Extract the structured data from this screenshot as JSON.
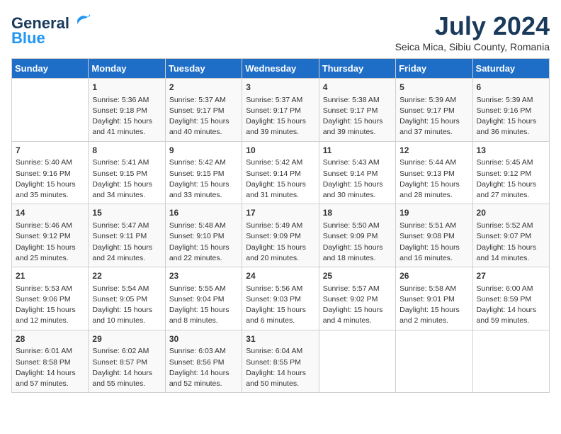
{
  "header": {
    "logo_line1": "General",
    "logo_line2": "Blue",
    "month_title": "July 2024",
    "subtitle": "Seica Mica, Sibiu County, Romania"
  },
  "days_of_week": [
    "Sunday",
    "Monday",
    "Tuesday",
    "Wednesday",
    "Thursday",
    "Friday",
    "Saturday"
  ],
  "weeks": [
    [
      {
        "day": "",
        "info": ""
      },
      {
        "day": "1",
        "info": "Sunrise: 5:36 AM\nSunset: 9:18 PM\nDaylight: 15 hours\nand 41 minutes."
      },
      {
        "day": "2",
        "info": "Sunrise: 5:37 AM\nSunset: 9:17 PM\nDaylight: 15 hours\nand 40 minutes."
      },
      {
        "day": "3",
        "info": "Sunrise: 5:37 AM\nSunset: 9:17 PM\nDaylight: 15 hours\nand 39 minutes."
      },
      {
        "day": "4",
        "info": "Sunrise: 5:38 AM\nSunset: 9:17 PM\nDaylight: 15 hours\nand 39 minutes."
      },
      {
        "day": "5",
        "info": "Sunrise: 5:39 AM\nSunset: 9:17 PM\nDaylight: 15 hours\nand 37 minutes."
      },
      {
        "day": "6",
        "info": "Sunrise: 5:39 AM\nSunset: 9:16 PM\nDaylight: 15 hours\nand 36 minutes."
      }
    ],
    [
      {
        "day": "7",
        "info": "Sunrise: 5:40 AM\nSunset: 9:16 PM\nDaylight: 15 hours\nand 35 minutes."
      },
      {
        "day": "8",
        "info": "Sunrise: 5:41 AM\nSunset: 9:15 PM\nDaylight: 15 hours\nand 34 minutes."
      },
      {
        "day": "9",
        "info": "Sunrise: 5:42 AM\nSunset: 9:15 PM\nDaylight: 15 hours\nand 33 minutes."
      },
      {
        "day": "10",
        "info": "Sunrise: 5:42 AM\nSunset: 9:14 PM\nDaylight: 15 hours\nand 31 minutes."
      },
      {
        "day": "11",
        "info": "Sunrise: 5:43 AM\nSunset: 9:14 PM\nDaylight: 15 hours\nand 30 minutes."
      },
      {
        "day": "12",
        "info": "Sunrise: 5:44 AM\nSunset: 9:13 PM\nDaylight: 15 hours\nand 28 minutes."
      },
      {
        "day": "13",
        "info": "Sunrise: 5:45 AM\nSunset: 9:12 PM\nDaylight: 15 hours\nand 27 minutes."
      }
    ],
    [
      {
        "day": "14",
        "info": "Sunrise: 5:46 AM\nSunset: 9:12 PM\nDaylight: 15 hours\nand 25 minutes."
      },
      {
        "day": "15",
        "info": "Sunrise: 5:47 AM\nSunset: 9:11 PM\nDaylight: 15 hours\nand 24 minutes."
      },
      {
        "day": "16",
        "info": "Sunrise: 5:48 AM\nSunset: 9:10 PM\nDaylight: 15 hours\nand 22 minutes."
      },
      {
        "day": "17",
        "info": "Sunrise: 5:49 AM\nSunset: 9:09 PM\nDaylight: 15 hours\nand 20 minutes."
      },
      {
        "day": "18",
        "info": "Sunrise: 5:50 AM\nSunset: 9:09 PM\nDaylight: 15 hours\nand 18 minutes."
      },
      {
        "day": "19",
        "info": "Sunrise: 5:51 AM\nSunset: 9:08 PM\nDaylight: 15 hours\nand 16 minutes."
      },
      {
        "day": "20",
        "info": "Sunrise: 5:52 AM\nSunset: 9:07 PM\nDaylight: 15 hours\nand 14 minutes."
      }
    ],
    [
      {
        "day": "21",
        "info": "Sunrise: 5:53 AM\nSunset: 9:06 PM\nDaylight: 15 hours\nand 12 minutes."
      },
      {
        "day": "22",
        "info": "Sunrise: 5:54 AM\nSunset: 9:05 PM\nDaylight: 15 hours\nand 10 minutes."
      },
      {
        "day": "23",
        "info": "Sunrise: 5:55 AM\nSunset: 9:04 PM\nDaylight: 15 hours\nand 8 minutes."
      },
      {
        "day": "24",
        "info": "Sunrise: 5:56 AM\nSunset: 9:03 PM\nDaylight: 15 hours\nand 6 minutes."
      },
      {
        "day": "25",
        "info": "Sunrise: 5:57 AM\nSunset: 9:02 PM\nDaylight: 15 hours\nand 4 minutes."
      },
      {
        "day": "26",
        "info": "Sunrise: 5:58 AM\nSunset: 9:01 PM\nDaylight: 15 hours\nand 2 minutes."
      },
      {
        "day": "27",
        "info": "Sunrise: 6:00 AM\nSunset: 8:59 PM\nDaylight: 14 hours\nand 59 minutes."
      }
    ],
    [
      {
        "day": "28",
        "info": "Sunrise: 6:01 AM\nSunset: 8:58 PM\nDaylight: 14 hours\nand 57 minutes."
      },
      {
        "day": "29",
        "info": "Sunrise: 6:02 AM\nSunset: 8:57 PM\nDaylight: 14 hours\nand 55 minutes."
      },
      {
        "day": "30",
        "info": "Sunrise: 6:03 AM\nSunset: 8:56 PM\nDaylight: 14 hours\nand 52 minutes."
      },
      {
        "day": "31",
        "info": "Sunrise: 6:04 AM\nSunset: 8:55 PM\nDaylight: 14 hours\nand 50 minutes."
      },
      {
        "day": "",
        "info": ""
      },
      {
        "day": "",
        "info": ""
      },
      {
        "day": "",
        "info": ""
      }
    ]
  ]
}
